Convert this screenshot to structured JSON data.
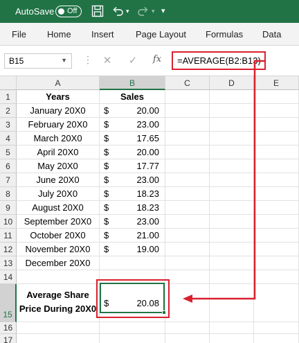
{
  "titlebar": {
    "autosave_label": "AutoSave",
    "autosave_state": "Off",
    "background": "#217346"
  },
  "menu": [
    "File",
    "Home",
    "Insert",
    "Page Layout",
    "Formulas",
    "Data"
  ],
  "formula_bar": {
    "name_box": "B15",
    "fx_label": "fx",
    "formula": "=AVERAGE(B2:B13)"
  },
  "columns": [
    "A",
    "B",
    "C",
    "D",
    "E"
  ],
  "rows": [
    {
      "num": "1",
      "a": "Years",
      "cur": "",
      "amt": "",
      "header": true
    },
    {
      "num": "2",
      "a": "January 20X0",
      "cur": "$",
      "amt": "20.00"
    },
    {
      "num": "3",
      "a": "February 20X0",
      "cur": "$",
      "amt": "23.00"
    },
    {
      "num": "4",
      "a": "March 20X0",
      "cur": "$",
      "amt": "17.65"
    },
    {
      "num": "5",
      "a": "April 20X0",
      "cur": "$",
      "amt": "20.00"
    },
    {
      "num": "6",
      "a": "May 20X0",
      "cur": "$",
      "amt": "17.77"
    },
    {
      "num": "7",
      "a": "June 20X0",
      "cur": "$",
      "amt": "23.00"
    },
    {
      "num": "8",
      "a": "July 20X0",
      "cur": "$",
      "amt": "18.23"
    },
    {
      "num": "9",
      "a": "August 20X0",
      "cur": "$",
      "amt": "18.23"
    },
    {
      "num": "10",
      "a": "September 20X0",
      "cur": "$",
      "amt": "23.00"
    },
    {
      "num": "11",
      "a": "October 20X0",
      "cur": "$",
      "amt": "21.00"
    },
    {
      "num": "12",
      "a": "November 20X0",
      "cur": "$",
      "amt": "19.00"
    },
    {
      "num": "13",
      "a": "December 20X0",
      "cur": "",
      "amt": ""
    },
    {
      "num": "14",
      "a": "",
      "cur": "",
      "amt": ""
    },
    {
      "num": "15",
      "a_line1": "Average Share",
      "a_line2": "Price During 20X0",
      "cur": "$",
      "amt": "20.08",
      "selected": true
    },
    {
      "num": "16",
      "a": "",
      "cur": "",
      "amt": ""
    },
    {
      "num": "17",
      "a": "",
      "cur": "",
      "amt": ""
    }
  ],
  "header_b": "Sales",
  "accent": "#217346",
  "highlight": "#d9212e"
}
